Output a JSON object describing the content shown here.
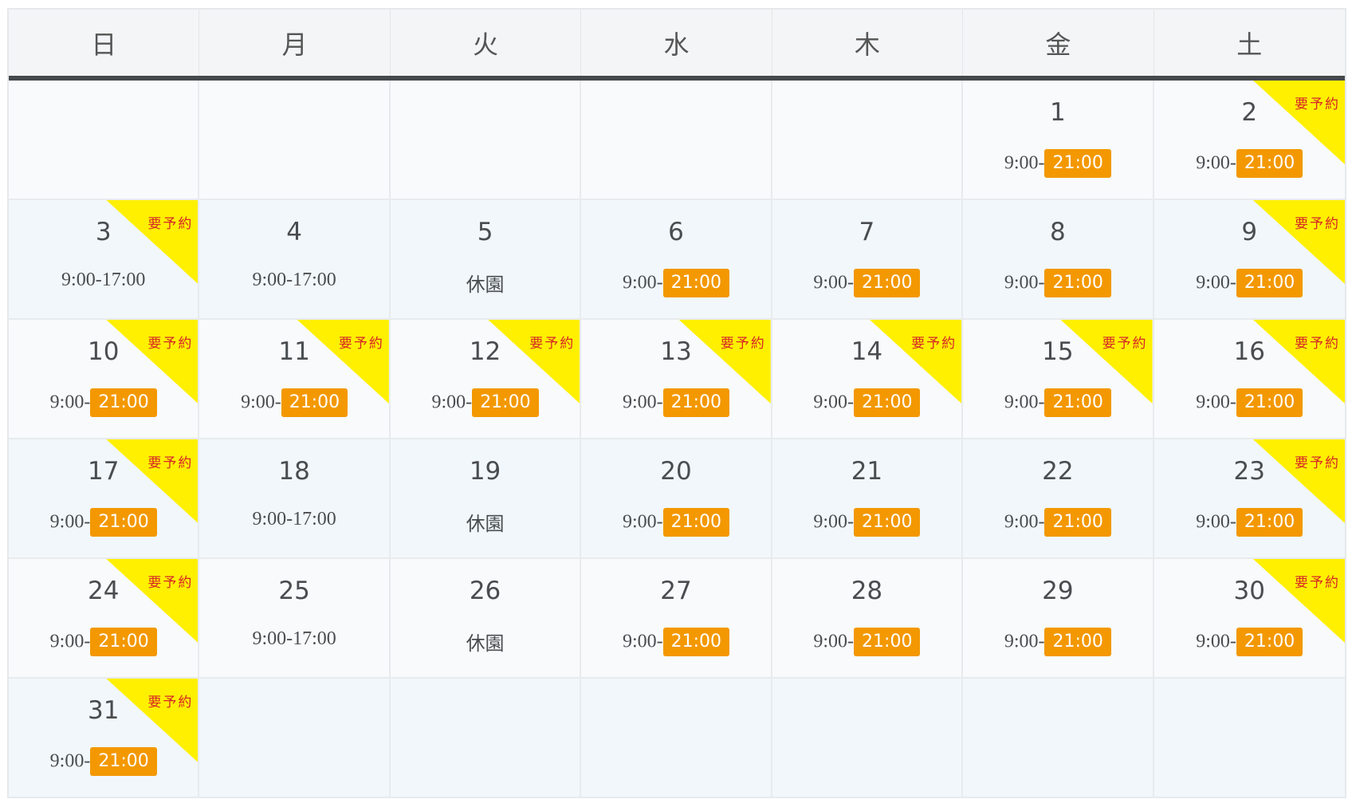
{
  "weekdays": [
    "日",
    "月",
    "火",
    "水",
    "木",
    "金",
    "土"
  ],
  "reservation_label": "要予約",
  "closed_label": "休園",
  "colors": {
    "header_bg": "#f4f5f6",
    "header_border": "#46494c",
    "badge_orange": "#f39800",
    "corner_yellow": "#fff000",
    "corner_text_red": "#d52828"
  },
  "weeks": [
    [
      null,
      null,
      null,
      null,
      null,
      {
        "day": "1",
        "open": "9:00-",
        "close": "21:00",
        "reservation": false
      },
      {
        "day": "2",
        "open": "9:00-",
        "close": "21:00",
        "reservation": true
      }
    ],
    [
      {
        "day": "3",
        "open": "9:00-17:00",
        "close": null,
        "reservation": true
      },
      {
        "day": "4",
        "open": "9:00-17:00",
        "close": null,
        "reservation": false
      },
      {
        "day": "5",
        "open": null,
        "close": null,
        "closed": true,
        "reservation": false
      },
      {
        "day": "6",
        "open": "9:00-",
        "close": "21:00",
        "reservation": false
      },
      {
        "day": "7",
        "open": "9:00-",
        "close": "21:00",
        "reservation": false
      },
      {
        "day": "8",
        "open": "9:00-",
        "close": "21:00",
        "reservation": false
      },
      {
        "day": "9",
        "open": "9:00-",
        "close": "21:00",
        "reservation": true
      }
    ],
    [
      {
        "day": "10",
        "open": "9:00-",
        "close": "21:00",
        "reservation": true
      },
      {
        "day": "11",
        "open": "9:00-",
        "close": "21:00",
        "reservation": true
      },
      {
        "day": "12",
        "open": "9:00-",
        "close": "21:00",
        "reservation": true
      },
      {
        "day": "13",
        "open": "9:00-",
        "close": "21:00",
        "reservation": true
      },
      {
        "day": "14",
        "open": "9:00-",
        "close": "21:00",
        "reservation": true
      },
      {
        "day": "15",
        "open": "9:00-",
        "close": "21:00",
        "reservation": true
      },
      {
        "day": "16",
        "open": "9:00-",
        "close": "21:00",
        "reservation": true
      }
    ],
    [
      {
        "day": "17",
        "open": "9:00-",
        "close": "21:00",
        "reservation": true
      },
      {
        "day": "18",
        "open": "9:00-17:00",
        "close": null,
        "reservation": false
      },
      {
        "day": "19",
        "open": null,
        "close": null,
        "closed": true,
        "reservation": false
      },
      {
        "day": "20",
        "open": "9:00-",
        "close": "21:00",
        "reservation": false
      },
      {
        "day": "21",
        "open": "9:00-",
        "close": "21:00",
        "reservation": false
      },
      {
        "day": "22",
        "open": "9:00-",
        "close": "21:00",
        "reservation": false
      },
      {
        "day": "23",
        "open": "9:00-",
        "close": "21:00",
        "reservation": true
      }
    ],
    [
      {
        "day": "24",
        "open": "9:00-",
        "close": "21:00",
        "reservation": true
      },
      {
        "day": "25",
        "open": "9:00-17:00",
        "close": null,
        "reservation": false
      },
      {
        "day": "26",
        "open": null,
        "close": null,
        "closed": true,
        "reservation": false
      },
      {
        "day": "27",
        "open": "9:00-",
        "close": "21:00",
        "reservation": false
      },
      {
        "day": "28",
        "open": "9:00-",
        "close": "21:00",
        "reservation": false
      },
      {
        "day": "29",
        "open": "9:00-",
        "close": "21:00",
        "reservation": false
      },
      {
        "day": "30",
        "open": "9:00-",
        "close": "21:00",
        "reservation": true
      }
    ],
    [
      {
        "day": "31",
        "open": "9:00-",
        "close": "21:00",
        "reservation": true
      },
      null,
      null,
      null,
      null,
      null,
      null
    ]
  ]
}
